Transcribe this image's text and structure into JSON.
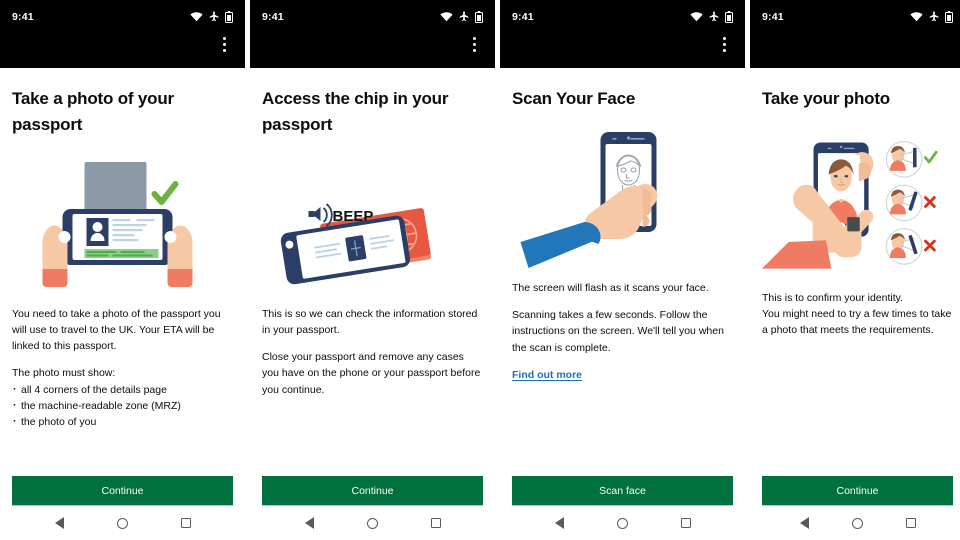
{
  "status_bar": {
    "time": "9:41",
    "icons": [
      "wifi-icon",
      "airplane-mode-icon",
      "battery-icon"
    ],
    "overflow_menu": "more-options"
  },
  "colors": {
    "button_green": "#00703c",
    "link_blue": "#1d70b8",
    "text_black": "#0b0c0c",
    "status_bar_black": "#000000"
  },
  "screens": [
    {
      "id": "passport-photo",
      "heading": "Take a photo of your\npassport",
      "illustration": "hands-holding-phone-scanning-passport-with-green-tick",
      "paragraphs": [
        "You need to take a photo of the passport you will use to travel to the UK. Your ETA will be linked to this passport.",
        "The photo must show:"
      ],
      "bullets": [
        "all 4 corners of the details page",
        "the machine-readable zone (MRZ)",
        "the photo of you"
      ],
      "link": null,
      "button": "Continue"
    },
    {
      "id": "passport-chip",
      "heading": "Access the chip in your\npassport",
      "illustration": "phone-on-passport-nfc-beep",
      "illustration_caption": "BEEP",
      "paragraphs": [
        "This is so we can check the information stored in your passport.",
        "Close your passport and remove any cases you have on the phone or your passport before you continue."
      ],
      "bullets": [],
      "link": null,
      "button": "Continue"
    },
    {
      "id": "scan-face",
      "heading": "Scan Your Face",
      "illustration": "hand-holding-phone-with-face-outline",
      "paragraphs": [
        "The screen will flash as it scans your face.",
        "Scanning takes a few seconds. Follow the instructions on the screen. We'll tell you when the scan is complete."
      ],
      "bullets": [],
      "link": "Find out more",
      "button": "Scan face"
    },
    {
      "id": "take-photo",
      "heading": "Take your photo",
      "illustration": "person-taking-selfie-with-angle-guides-tick-and-crosses",
      "paragraphs": [
        "This is to confirm your identity.\nYou might need to try a few times to take a photo that meets the requirements."
      ],
      "bullets": [],
      "link": null,
      "button": "Continue"
    }
  ],
  "nav_bar": {
    "back": "back-button",
    "home": "home-button",
    "recents": "recents-button"
  }
}
